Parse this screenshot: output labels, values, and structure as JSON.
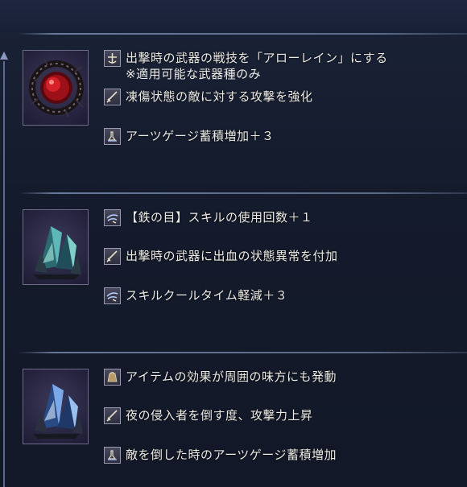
{
  "items": [
    {
      "icon": "red-gem-in-thorns-icon",
      "effects": [
        {
          "icon": "weapon-skill-icon",
          "text": "出撃時の武器の戦技を「アローレイン」にする",
          "sub": "※適用可能な武器種のみ"
        },
        {
          "icon": "sword-icon",
          "text": "凍傷状態の敵に対する攻撃を強化",
          "sub": ""
        },
        {
          "icon": "art-gauge-icon",
          "text": "アーツゲージ蓄積増加＋３",
          "sub": ""
        }
      ]
    },
    {
      "icon": "teal-crystal-cluster-icon",
      "effects": [
        {
          "icon": "skill-wind-icon",
          "text": "【鉄の目】スキルの使用回数＋１",
          "sub": ""
        },
        {
          "icon": "sword-icon",
          "text": "出撃時の武器に出血の状態異常を付加",
          "sub": ""
        },
        {
          "icon": "skill-wind-icon",
          "text": "スキルクールタイム軽減＋３",
          "sub": ""
        }
      ]
    },
    {
      "icon": "blue-crystal-cluster-icon",
      "effects": [
        {
          "icon": "item-pouch-icon",
          "text": "アイテムの効果が周囲の味方にも発動",
          "sub": ""
        },
        {
          "icon": "sword-icon",
          "text": "夜の侵入者を倒す度、攻撃力上昇",
          "sub": ""
        },
        {
          "icon": "art-gauge-icon",
          "text": "敵を倒した時のアーツゲージ蓄積増加",
          "sub": ""
        }
      ]
    }
  ]
}
